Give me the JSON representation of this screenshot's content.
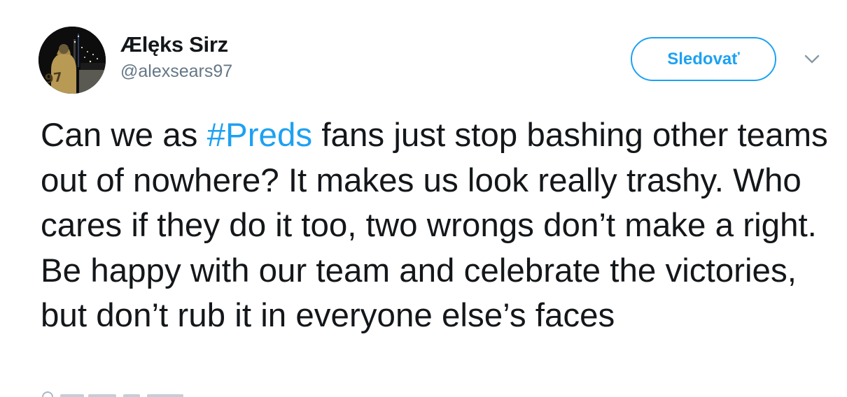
{
  "user": {
    "display_name": "Ælęks Sirz",
    "handle": "@alexsears97",
    "avatar_jersey_number": "97"
  },
  "actions": {
    "follow_label": "Sledovať",
    "more_icon": "chevron-down-icon"
  },
  "tweet": {
    "text_before": "Can we as ",
    "hashtag": "#Preds",
    "text_after": " fans just stop bashing other teams out of nowhere? It makes us look really trashy. Who cares if they do it too, two wrongs don’t make a right. Be happy with our team and celebrate the victories, but don’t rub it in everyone else’s faces"
  },
  "colors": {
    "accent": "#1da1f2",
    "text": "#14171a",
    "secondary_text": "#657786"
  }
}
